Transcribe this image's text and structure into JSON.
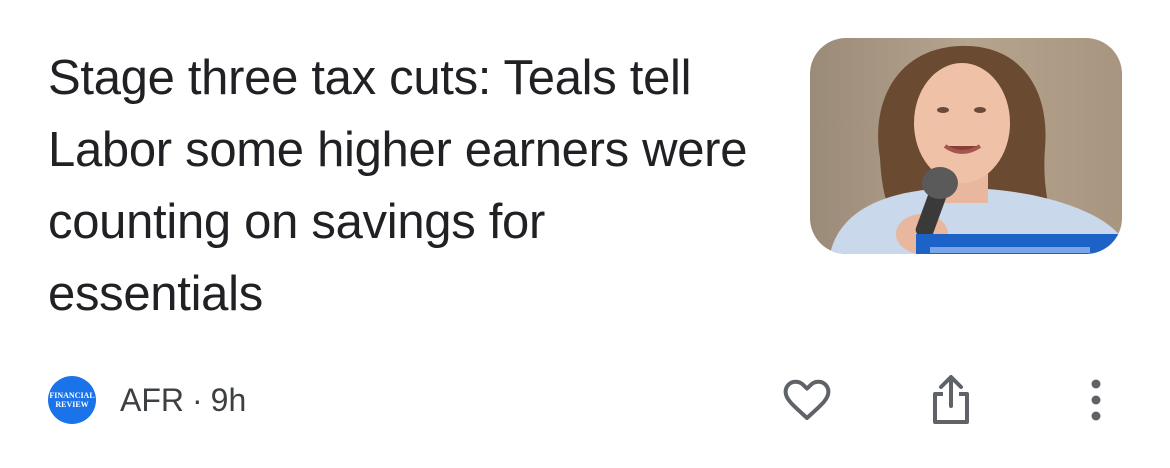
{
  "article": {
    "headline": "Stage three tax cuts: Teals tell Labor some higher earners were counting on savings for essentials",
    "source_logo_line1": "FINANCIAL",
    "source_logo_line2": "REVIEW",
    "source_name": "AFR",
    "separator": "·",
    "age": "9h"
  },
  "icons": {
    "like": "heart-outline-icon",
    "share": "share-icon",
    "more": "more-vertical-icon"
  },
  "colors": {
    "text": "#202124",
    "meta_text": "#3c4043",
    "icon": "#5f6368",
    "source_logo_bg": "#1a73e8"
  }
}
